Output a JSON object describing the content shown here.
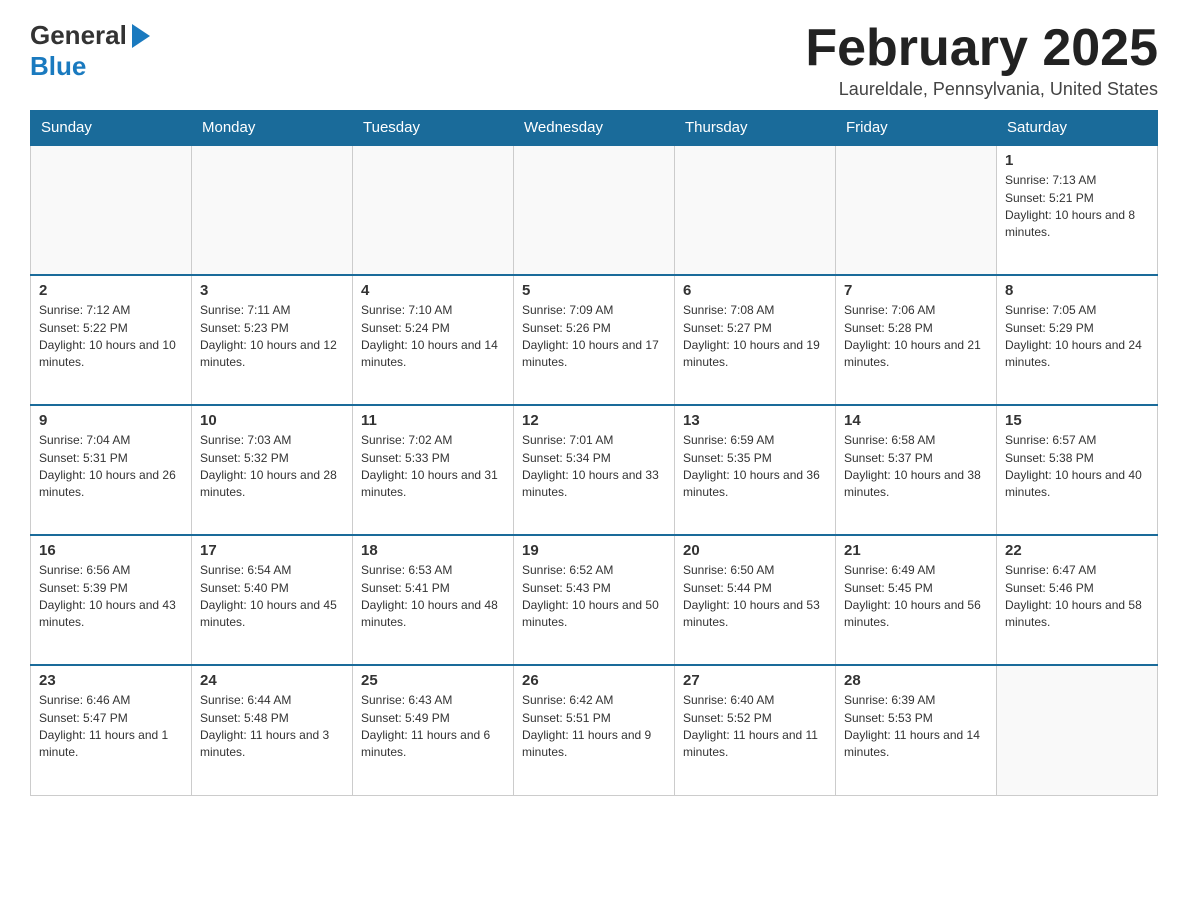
{
  "header": {
    "logo_general": "General",
    "logo_blue": "Blue",
    "month_title": "February 2025",
    "location": "Laureldale, Pennsylvania, United States"
  },
  "weekdays": [
    "Sunday",
    "Monday",
    "Tuesday",
    "Wednesday",
    "Thursday",
    "Friday",
    "Saturday"
  ],
  "weeks": [
    [
      {
        "day": "",
        "info": ""
      },
      {
        "day": "",
        "info": ""
      },
      {
        "day": "",
        "info": ""
      },
      {
        "day": "",
        "info": ""
      },
      {
        "day": "",
        "info": ""
      },
      {
        "day": "",
        "info": ""
      },
      {
        "day": "1",
        "info": "Sunrise: 7:13 AM\nSunset: 5:21 PM\nDaylight: 10 hours and 8 minutes."
      }
    ],
    [
      {
        "day": "2",
        "info": "Sunrise: 7:12 AM\nSunset: 5:22 PM\nDaylight: 10 hours and 10 minutes."
      },
      {
        "day": "3",
        "info": "Sunrise: 7:11 AM\nSunset: 5:23 PM\nDaylight: 10 hours and 12 minutes."
      },
      {
        "day": "4",
        "info": "Sunrise: 7:10 AM\nSunset: 5:24 PM\nDaylight: 10 hours and 14 minutes."
      },
      {
        "day": "5",
        "info": "Sunrise: 7:09 AM\nSunset: 5:26 PM\nDaylight: 10 hours and 17 minutes."
      },
      {
        "day": "6",
        "info": "Sunrise: 7:08 AM\nSunset: 5:27 PM\nDaylight: 10 hours and 19 minutes."
      },
      {
        "day": "7",
        "info": "Sunrise: 7:06 AM\nSunset: 5:28 PM\nDaylight: 10 hours and 21 minutes."
      },
      {
        "day": "8",
        "info": "Sunrise: 7:05 AM\nSunset: 5:29 PM\nDaylight: 10 hours and 24 minutes."
      }
    ],
    [
      {
        "day": "9",
        "info": "Sunrise: 7:04 AM\nSunset: 5:31 PM\nDaylight: 10 hours and 26 minutes."
      },
      {
        "day": "10",
        "info": "Sunrise: 7:03 AM\nSunset: 5:32 PM\nDaylight: 10 hours and 28 minutes."
      },
      {
        "day": "11",
        "info": "Sunrise: 7:02 AM\nSunset: 5:33 PM\nDaylight: 10 hours and 31 minutes."
      },
      {
        "day": "12",
        "info": "Sunrise: 7:01 AM\nSunset: 5:34 PM\nDaylight: 10 hours and 33 minutes."
      },
      {
        "day": "13",
        "info": "Sunrise: 6:59 AM\nSunset: 5:35 PM\nDaylight: 10 hours and 36 minutes."
      },
      {
        "day": "14",
        "info": "Sunrise: 6:58 AM\nSunset: 5:37 PM\nDaylight: 10 hours and 38 minutes."
      },
      {
        "day": "15",
        "info": "Sunrise: 6:57 AM\nSunset: 5:38 PM\nDaylight: 10 hours and 40 minutes."
      }
    ],
    [
      {
        "day": "16",
        "info": "Sunrise: 6:56 AM\nSunset: 5:39 PM\nDaylight: 10 hours and 43 minutes."
      },
      {
        "day": "17",
        "info": "Sunrise: 6:54 AM\nSunset: 5:40 PM\nDaylight: 10 hours and 45 minutes."
      },
      {
        "day": "18",
        "info": "Sunrise: 6:53 AM\nSunset: 5:41 PM\nDaylight: 10 hours and 48 minutes."
      },
      {
        "day": "19",
        "info": "Sunrise: 6:52 AM\nSunset: 5:43 PM\nDaylight: 10 hours and 50 minutes."
      },
      {
        "day": "20",
        "info": "Sunrise: 6:50 AM\nSunset: 5:44 PM\nDaylight: 10 hours and 53 minutes."
      },
      {
        "day": "21",
        "info": "Sunrise: 6:49 AM\nSunset: 5:45 PM\nDaylight: 10 hours and 56 minutes."
      },
      {
        "day": "22",
        "info": "Sunrise: 6:47 AM\nSunset: 5:46 PM\nDaylight: 10 hours and 58 minutes."
      }
    ],
    [
      {
        "day": "23",
        "info": "Sunrise: 6:46 AM\nSunset: 5:47 PM\nDaylight: 11 hours and 1 minute."
      },
      {
        "day": "24",
        "info": "Sunrise: 6:44 AM\nSunset: 5:48 PM\nDaylight: 11 hours and 3 minutes."
      },
      {
        "day": "25",
        "info": "Sunrise: 6:43 AM\nSunset: 5:49 PM\nDaylight: 11 hours and 6 minutes."
      },
      {
        "day": "26",
        "info": "Sunrise: 6:42 AM\nSunset: 5:51 PM\nDaylight: 11 hours and 9 minutes."
      },
      {
        "day": "27",
        "info": "Sunrise: 6:40 AM\nSunset: 5:52 PM\nDaylight: 11 hours and 11 minutes."
      },
      {
        "day": "28",
        "info": "Sunrise: 6:39 AM\nSunset: 5:53 PM\nDaylight: 11 hours and 14 minutes."
      },
      {
        "day": "",
        "info": ""
      }
    ]
  ]
}
